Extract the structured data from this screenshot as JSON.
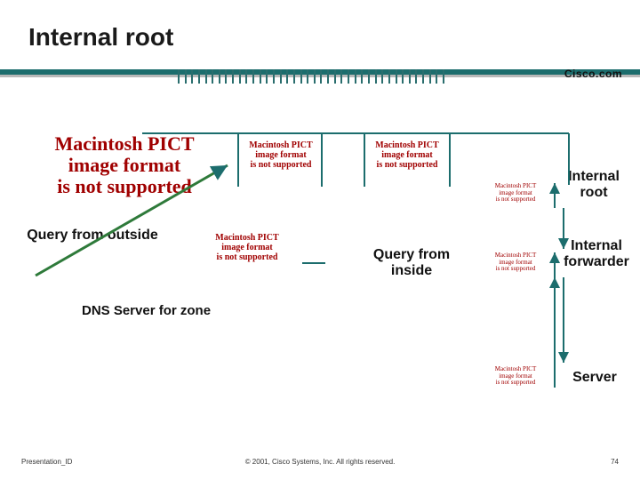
{
  "title": "Internal root",
  "brand": "Cisco.com",
  "pict_lg": {
    "l1": "Macintosh PICT",
    "l2": "image format",
    "l3": "is not supported"
  },
  "pict_md": {
    "l1": "Macintosh PICT",
    "l2": "image format",
    "l3": "is not supported"
  },
  "pict_sm": {
    "l1": "Macintosh PICT",
    "l2": "image format",
    "l3": "is not supported"
  },
  "labels": {
    "internal_root": "Internal\nroot",
    "query_outside": "Query from outside",
    "query_inside": "Query from\ninside",
    "internal_forwarder": "Internal\nforwarder",
    "dns_zone": "DNS Server for zone",
    "server": "Server"
  },
  "footer": {
    "left": "Presentation_ID",
    "center": "© 2001, Cisco Systems, Inc. All rights reserved.",
    "right": "74"
  }
}
